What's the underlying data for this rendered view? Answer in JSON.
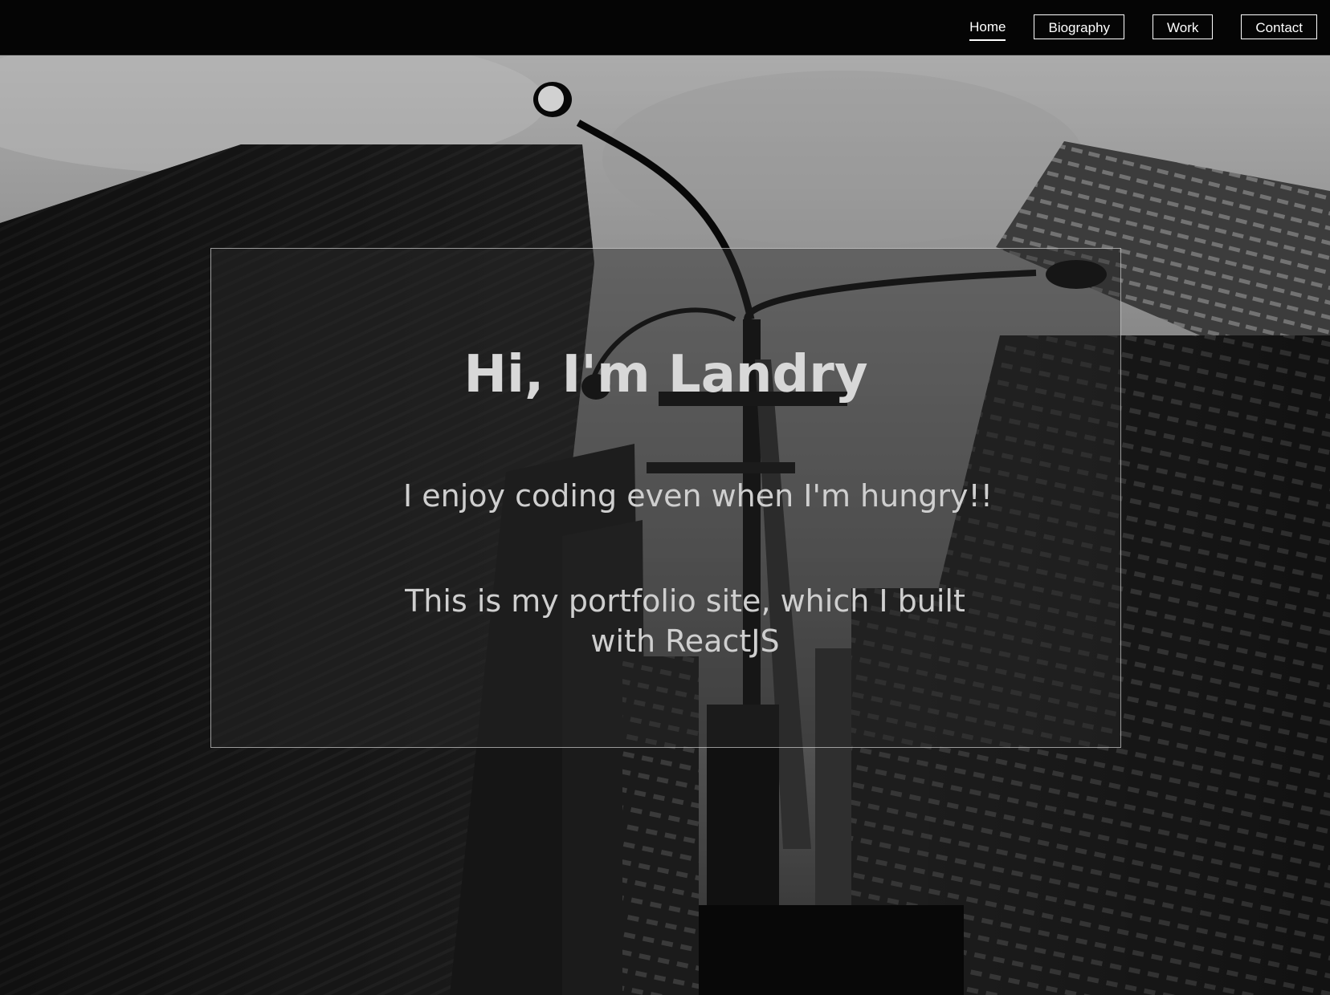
{
  "nav": {
    "items": [
      {
        "label": "Home",
        "active": true
      },
      {
        "label": "Biography",
        "active": false
      },
      {
        "label": "Work",
        "active": false
      },
      {
        "label": "Contact",
        "active": false
      }
    ]
  },
  "hero": {
    "background_image": "black-and-white-skyscrapers-with-street-lamp"
  },
  "intro": {
    "title": "Hi, I'm Landry",
    "tagline": "I enjoy coding even when I'm hungry!!",
    "description": "This is my portfolio site, which I built with ReactJS"
  },
  "colors": {
    "navbar_bg": "#050505",
    "text": "#ffffff",
    "card_border": "#b0b0b0"
  }
}
